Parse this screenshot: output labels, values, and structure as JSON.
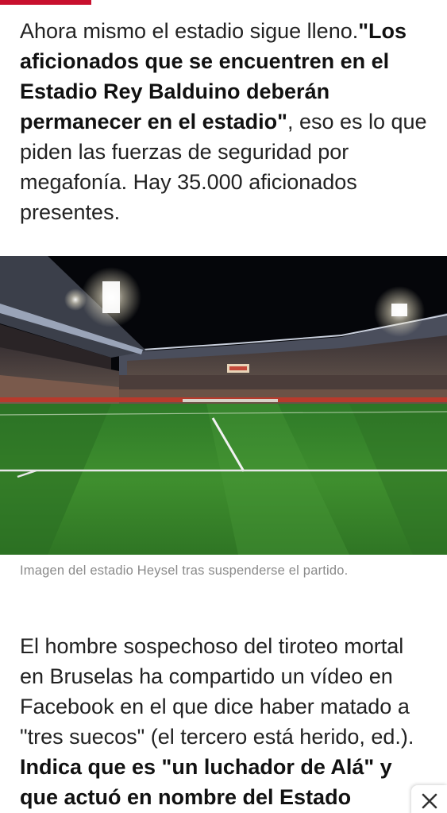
{
  "article": {
    "para1": {
      "intro": "Ahora mismo el estadio sigue lleno.",
      "quote": "\"Los aficionados que se encuentren en el Estadio Rey Balduino deberán permanecer en el estadio\"",
      "rest": ", eso es lo que piden las fuerzas de seguridad por megafonía. Hay 35.000 aficionados presentes."
    },
    "image": {
      "alt": "stadium-photo"
    },
    "caption": "Imagen del estadio Heysel tras suspenderse el partido.",
    "para2": {
      "text": "El hombre sospechoso del tiroteo mortal en Bruselas ha compartido un vídeo en Facebook en el que dice haber matado a \"tres suecos\" (el tercero está herido, ed.).",
      "bold": "Indica que es \"un luchador de Alá\" y que actuó en nombre del Estado Islámico"
    }
  },
  "ad": {
    "close_icon": "close-icon"
  },
  "colors": {
    "accent": "#c8102e",
    "text": "#222222",
    "caption": "#8a8a8a"
  }
}
